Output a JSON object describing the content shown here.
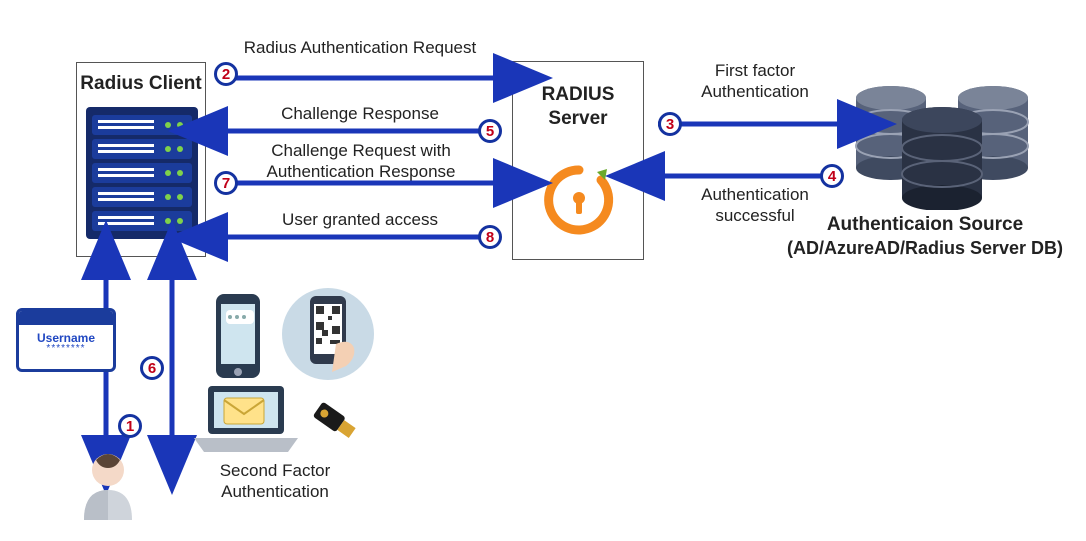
{
  "nodes": {
    "client_title": "Radius Client",
    "server_title_l1": "RADIUS",
    "server_title_l2": "Server",
    "authsrc_l1": "Authenticaion Source",
    "authsrc_l2": "(AD/AzureAD/Radius Server DB)",
    "second_factor_l1": "Second Factor",
    "second_factor_l2": "Authentication",
    "username_label": "Username",
    "username_mask": "********"
  },
  "flows": {
    "f2": "Radius Authentication Request",
    "f5": "Challenge Response",
    "f7_l1": "Challenge Request with",
    "f7_l2": "Authentication Response",
    "f8": "User granted access",
    "f3_l1": "First factor",
    "f3_l2": "Authentication",
    "f4_l1": "Authentication",
    "f4_l2": "successful"
  },
  "steps": [
    "1",
    "2",
    "3",
    "4",
    "5",
    "6",
    "7",
    "8"
  ]
}
